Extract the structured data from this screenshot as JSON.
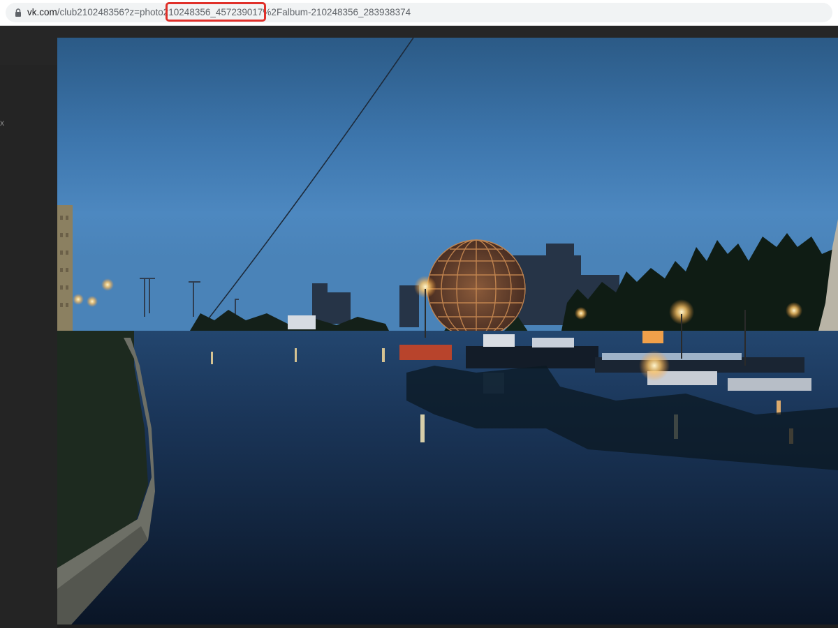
{
  "browser": {
    "url_host": "vk.com",
    "url_path": "/club210248356?z=photo210248356_457239017%2Falbum-210248356_283938374",
    "highlighted_fragment": "210248356_457239017",
    "highlight_color": "#e0302a"
  },
  "viewer": {
    "close_glyph": "x",
    "photo_subject": "night river scene with illuminated sphere"
  }
}
